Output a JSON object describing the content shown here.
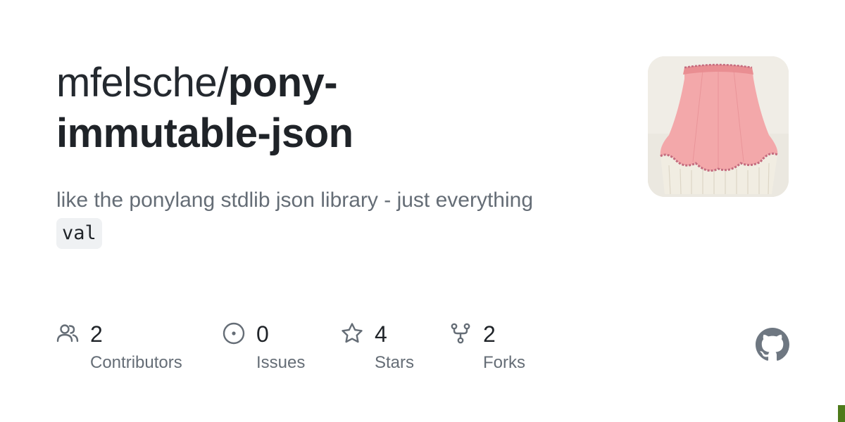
{
  "repo": {
    "owner": "mfelsche",
    "separator": "/",
    "name_line1": "pony-",
    "name_line2": "immutable-json"
  },
  "description": {
    "text": "like the ponylang stdlib json library - just everything",
    "code": "val"
  },
  "avatar": {
    "icon": "lampshade-image",
    "colors": {
      "shade": "#f3a8aa",
      "fringe": "#f1ede2",
      "background": "#e9e5dc"
    }
  },
  "stats": [
    {
      "icon": "people-icon",
      "value": "2",
      "label": "Contributors"
    },
    {
      "icon": "issue-opened-icon",
      "value": "0",
      "label": "Issues"
    },
    {
      "icon": "star-icon",
      "value": "4",
      "label": "Stars"
    },
    {
      "icon": "repo-forked-icon",
      "value": "2",
      "label": "Forks"
    }
  ],
  "brand": {
    "logo": "github-mark-icon",
    "logo_color": "#6e7781",
    "language_color": "#4e7a1a"
  }
}
